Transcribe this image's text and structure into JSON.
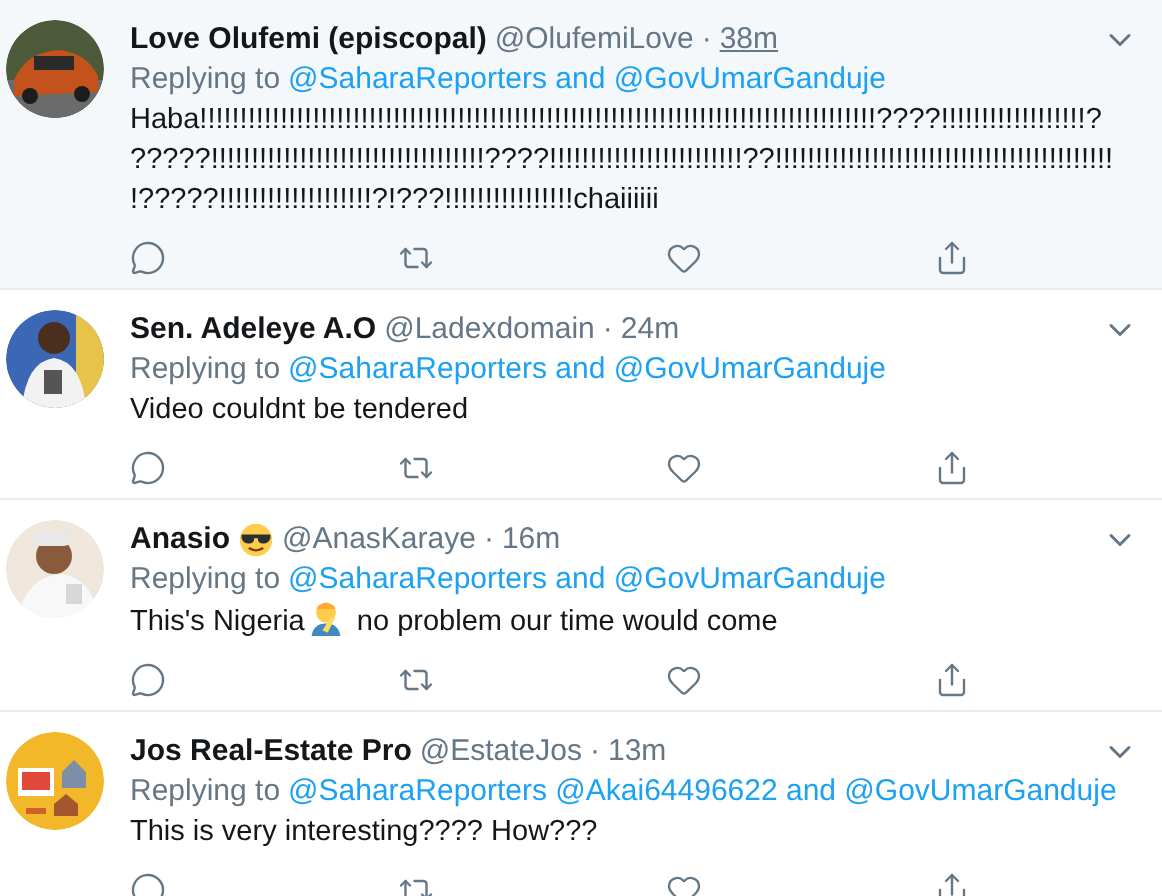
{
  "tweets": [
    {
      "name": "Love Olufemi (episcopal)",
      "handle": "@OlufemiLove",
      "separator": "·",
      "time": "38m",
      "hovered": true,
      "replying_label": "Replying to",
      "replying_to": "@SaharaReporters and @GovUmarGanduje",
      "body": [
        "Haba!!!!!!!!!!!!!!!!!!!!!!!!!!!!!!!!!!!!!!!!!!!!!!!!!!!!!!!!!!!!!!!!!!!!!!!!!!!!!!!!!!!!????!!!!!!!!!!!!!!!!!!?",
        "?????!!!!!!!!!!!!!!!!!!!!!!!!!!!!!!!!!!????!!!!!!!!!!!!!!!!!!!!!!!!??!!!!!!!!!!!!!!!!!!!!!!!!!!!!!!!!!!!!!!!!!!",
        "!?????!!!!!!!!!!!!!!!!!!!?!???!!!!!!!!!!!!!!!!chaiiiiii"
      ]
    },
    {
      "name": "Sen. Adeleye A.O",
      "handle": "@Ladexdomain",
      "separator": "·",
      "time": "24m",
      "hovered": false,
      "replying_label": "Replying to",
      "replying_to": "@SaharaReporters and @GovUmarGanduje",
      "body": [
        "Video couldnt be tendered"
      ]
    },
    {
      "name": "Anasio",
      "name_emoji": {
        "kind": "sunglasses"
      },
      "handle": "@AnasKaraye",
      "separator": "·",
      "time": "16m",
      "hovered": false,
      "replying_label": "Replying to",
      "replying_to": "@SaharaReporters and @GovUmarGanduje",
      "body": [
        "This's Nigeria"
      ],
      "body_emoji": {
        "kind": "facepalm"
      },
      "body_after": "no problem our time would come"
    },
    {
      "name": "Jos Real-Estate Pro",
      "handle": "@EstateJos",
      "separator": "·",
      "time": "13m",
      "hovered": false,
      "replying_label": "Replying to",
      "replying_to": "@SaharaReporters @Akai64496622 and @GovUmarGanduje",
      "body": [
        "This is very interesting???? How???"
      ]
    }
  ]
}
